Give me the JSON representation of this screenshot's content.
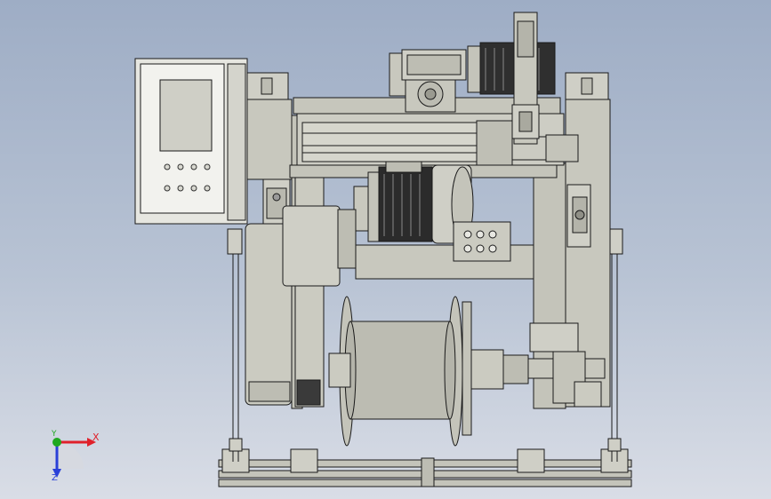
{
  "viewport": {
    "background_top": "#9eadc5",
    "background_bottom": "#d9dde6",
    "part_color": "#c8c8be",
    "edge_color": "#1a1a1a"
  },
  "triad": {
    "x_label": "X",
    "y_label": "Y",
    "z_label": "Z",
    "x_color": "#e0202a",
    "y_color": "#1fa81f",
    "z_color": "#2a40d8"
  }
}
